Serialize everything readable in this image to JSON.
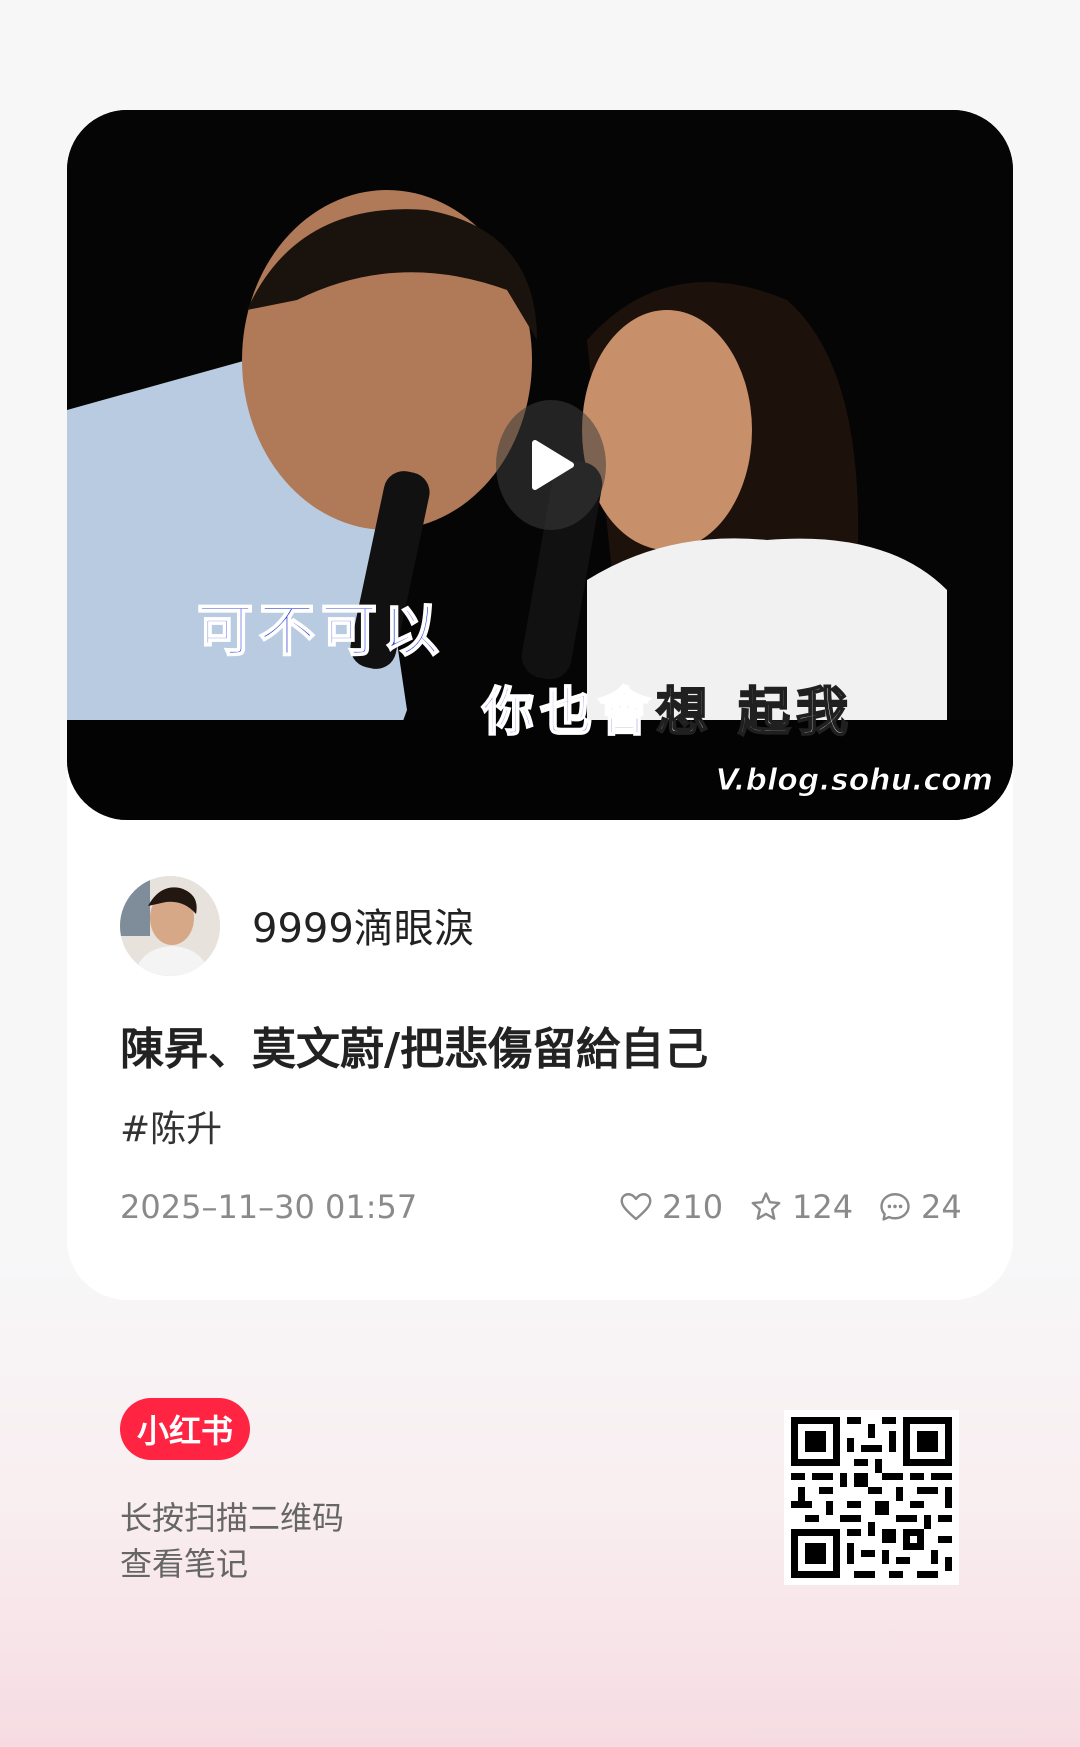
{
  "video": {
    "caption_left": "可不可以",
    "caption_right_a": "你也會",
    "caption_right_b": "想  起我",
    "watermark": "V.blog.sohu.com"
  },
  "author": {
    "name": "9999滴眼淚"
  },
  "note": {
    "title": "陳昇、莫文蔚/把悲傷留給自己",
    "tag": "#陈升",
    "timestamp": "2025–11–30 01:57",
    "likes": "210",
    "favorites": "124",
    "comments": "24"
  },
  "footer": {
    "logo_text": "小红书",
    "hint_line1": "长按扫描二维码",
    "hint_line2": "查看笔记"
  },
  "colors": {
    "brand": "#ff2442",
    "caption_blue": "#2a3bd6"
  }
}
